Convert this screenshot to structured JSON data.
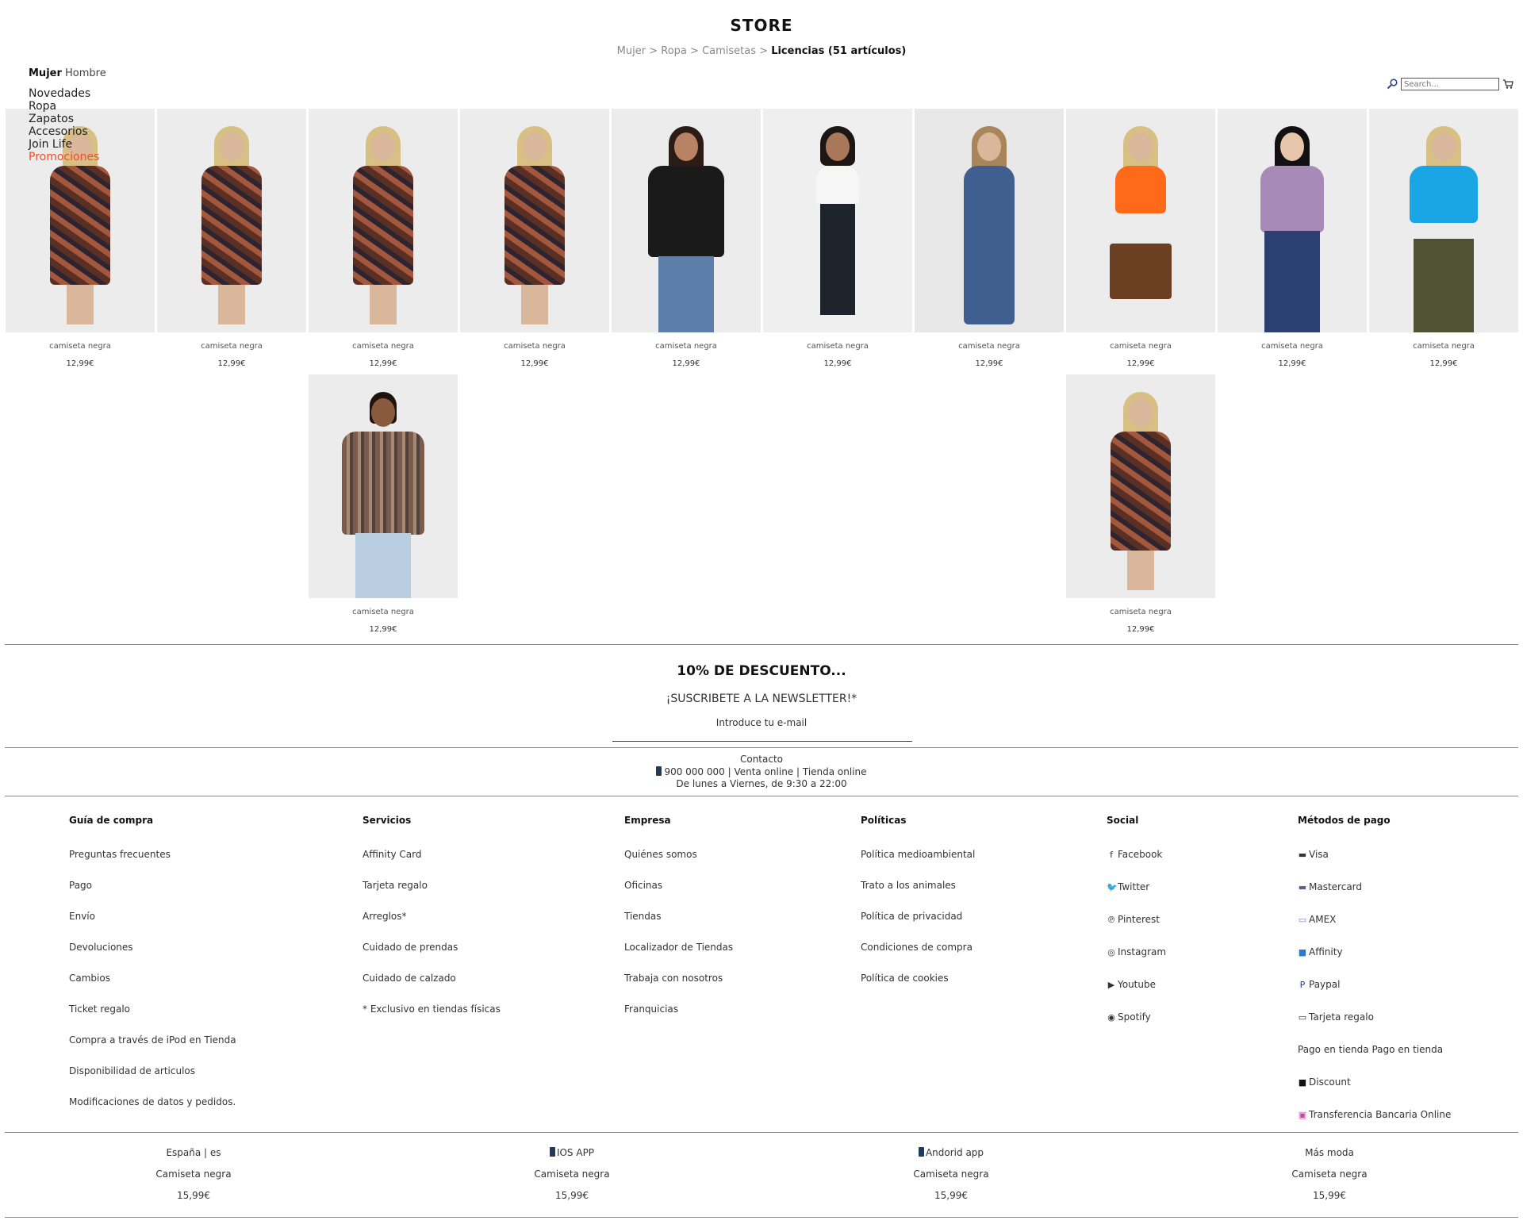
{
  "store_title": "STORE",
  "breadcrumb": {
    "items": [
      "Mujer",
      "Ropa",
      "Camisetas"
    ],
    "separator": ">",
    "current": "Licencias (51 artículos)"
  },
  "gender": {
    "active": "Mujer",
    "other": "Hombre"
  },
  "category_menu": [
    "Novedades",
    "Ropa",
    "Zapatos",
    "Accesorios",
    "Join Life"
  ],
  "promo_menu": "Promociones",
  "search": {
    "placeholder": "Search..."
  },
  "products": [
    {
      "name": "camiseta negra",
      "price": "12,99€"
    },
    {
      "name": "camiseta negra",
      "price": "12,99€"
    },
    {
      "name": "camiseta negra",
      "price": "12,99€"
    },
    {
      "name": "camiseta negra",
      "price": "12,99€"
    },
    {
      "name": "camiseta negra",
      "price": "12,99€"
    },
    {
      "name": "camiseta negra",
      "price": "12,99€"
    },
    {
      "name": "camiseta negra",
      "price": "12,99€"
    },
    {
      "name": "camiseta negra",
      "price": "12,99€"
    },
    {
      "name": "camiseta negra",
      "price": "12,99€"
    },
    {
      "name": "camiseta negra",
      "price": "12,99€"
    },
    {
      "name": "camiseta negra",
      "price": "12,99€"
    },
    {
      "name": "camiseta negra",
      "price": "12,99€"
    }
  ],
  "newsletter": {
    "title": "10% DE DESCUENTO...",
    "subtitle": "¡SUSCRIBETE A LA NEWSLETTER!*",
    "email_label": "Introduce tu e-mail"
  },
  "contact": {
    "title": "Contacto",
    "line": "900 000 000 | Venta online | Tienda online",
    "hours": "De lunes a Viernes, de 9:30 a 22:00"
  },
  "footer": {
    "guia": {
      "title": "Guía de compra",
      "items": [
        "Preguntas frecuentes",
        "Pago",
        "Envío",
        "Devoluciones",
        "Cambios",
        "Ticket regalo",
        "Compra a través de iPod en Tienda",
        "Disponibilidad de articulos",
        "Modificaciones de datos y pedidos."
      ]
    },
    "servicios": {
      "title": "Servicios",
      "items": [
        "Affinity Card",
        "Tarjeta regalo",
        "Arreglos*",
        "Cuidado de prendas",
        "Cuidado de calzado",
        "* Exclusivo en tiendas físicas"
      ]
    },
    "empresa": {
      "title": "Empresa",
      "items": [
        "Quiénes somos",
        "Oficinas",
        "Tiendas",
        "Localizador de Tiendas",
        "Trabaja con nosotros",
        "Franquicias"
      ]
    },
    "politicas": {
      "title": "Políticas",
      "items": [
        "Política medioambiental",
        "Trato a los animales",
        "Política de privacidad",
        "Condiciones de compra",
        "Política de cookies"
      ]
    },
    "social": {
      "title": "Social",
      "items": [
        {
          "label": "Facebook",
          "icon": "facebook-icon"
        },
        {
          "label": "Twitter",
          "icon": "twitter-icon"
        },
        {
          "label": "Pinterest",
          "icon": "pinterest-icon"
        },
        {
          "label": "Instagram",
          "icon": "instagram-icon"
        },
        {
          "label": "Youtube",
          "icon": "youtube-icon"
        },
        {
          "label": "Spotify",
          "icon": "spotify-icon"
        }
      ]
    },
    "pagos": {
      "title": "Métodos de pago",
      "items": [
        {
          "label": "Visa",
          "icon": "visa-icon"
        },
        {
          "label": "Mastercard",
          "icon": "mastercard-icon"
        },
        {
          "label": "AMEX",
          "icon": "amex-icon"
        },
        {
          "label": "Affinity",
          "icon": "affinity-icon"
        },
        {
          "label": "Paypal",
          "icon": "paypal-icon"
        },
        {
          "label": "Tarjeta regalo",
          "icon": "gift-card-icon"
        },
        {
          "label": "Pago en tienda Pago en tienda",
          "icon": "broken-image-icon"
        },
        {
          "label": "Discount",
          "icon": "discount-icon"
        },
        {
          "label": "Transferencia Bancaria Online",
          "icon": "bank-transfer-icon"
        }
      ]
    }
  },
  "bottom": [
    {
      "top": "España | es",
      "name": "Camiseta negra",
      "price": "15,99€"
    },
    {
      "top": "IOS APP",
      "name": "Camiseta negra",
      "price": "15,99€"
    },
    {
      "top": "Andorid app",
      "name": "Camiseta negra",
      "price": "15,99€"
    },
    {
      "top": "Más moda",
      "name": "Camiseta negra",
      "price": "15,99€"
    }
  ]
}
